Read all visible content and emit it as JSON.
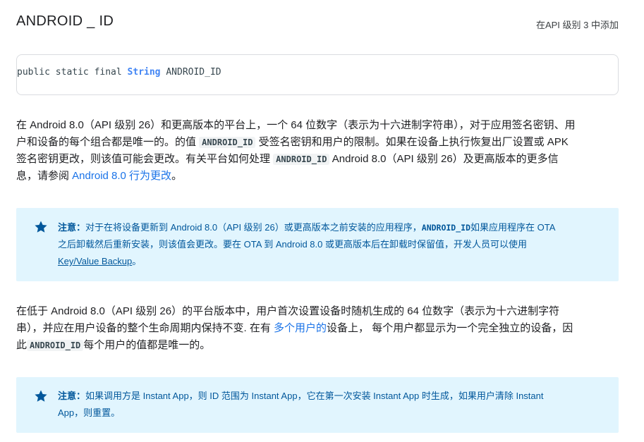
{
  "header": {
    "title": "ANDROID _ ID",
    "added_in": "在API 级别 3 中添加"
  },
  "signature": {
    "prefix": "public static final ",
    "type": "String",
    "name": " ANDROID_ID"
  },
  "para1": {
    "l1": "在 Android 8.0（API 级别 26）和更高版本的平台上，一个 64 位数字（表示为十六进制字符串），对于应用签名密钥、用",
    "l2a": "户和设备的每个组合都是唯一的。的值 ",
    "l2code": "ANDROID_ID",
    "l2b": " 受签名密钥和用户的限制。如果在设备上执行恢复出厂设置或 APK",
    "l3a": "签名密钥更改，则该值可能会更改。有关平台如何处理 ",
    "l3code": "ANDROID_ID",
    "l3b": " Android 8.0（API 级别 26）及更高版本的更多信",
    "l4a": "息，请参阅 ",
    "l4link": "Android 8.0 行为更改",
    "l4b": "。"
  },
  "note1": {
    "label": "注意：",
    "l1a": "对于在将设备更新到 Android 8.0（API 级别 26）或更高版本之前安装的应用程序，",
    "l1code": "ANDROID_ID",
    "l1b": "如果应用程序在 OTA",
    "l2": "之后卸载然后重新安装，则该值会更改。要在 OTA 到 Android 8.0 或更高版本后在卸载时保留值，开发人员可以使用",
    "l3link": "Key/Value Backup",
    "l3b": "。"
  },
  "para2": {
    "l1": "在低于 Android 8.0（API 级别 26）的平台版本中，用户首次设置设备时随机生成的 64 位数字（表示为十六进制字符",
    "l2a": "串），并应在用户设备的整个生命周期内保持不变. 在有 ",
    "l2link": "多个用户的",
    "l2b": "设备上， 每个用户都显示为一个完全独立的设备，因",
    "l3a": "此",
    "l3code": "ANDROID_ID",
    "l3b": "每个用户的值都是唯一的。"
  },
  "note2": {
    "label": "注意：",
    "l1": "如果调用方是 Instant App，则 ID 范围为 Instant App，它在第一次安装 Instant App 时生成，如果用户清除 Instant",
    "l2": "App，则重置。"
  },
  "icons": {
    "note_icon": "star-icon"
  },
  "colors": {
    "note_background": "#e1f5fe",
    "note_text": "#01579b",
    "link": "#1a73e8",
    "type_highlight": "#4285f4"
  }
}
